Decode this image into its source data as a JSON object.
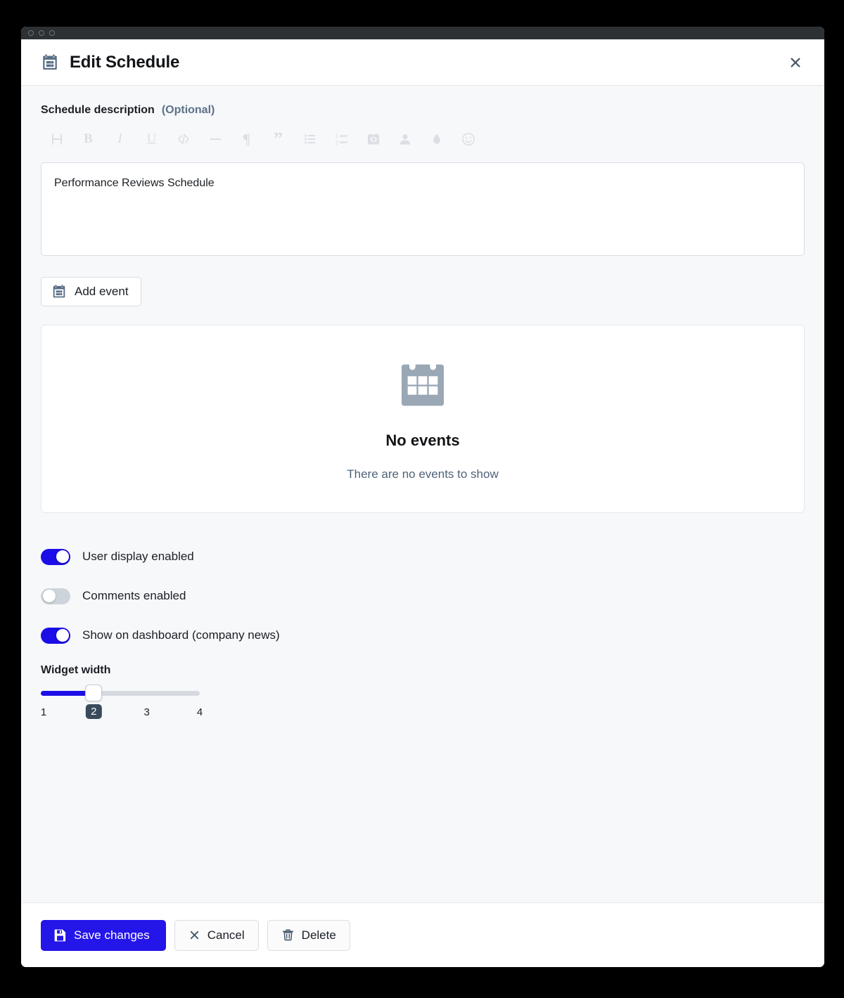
{
  "window": {
    "traffic_lights": [
      "close",
      "minimize",
      "zoom"
    ]
  },
  "header": {
    "icon": "calendar-icon",
    "title": "Edit Schedule",
    "close_icon": "close-icon"
  },
  "description_field": {
    "label": "Schedule description",
    "optional_tag": "(Optional)",
    "value": "Performance Reviews Schedule",
    "placeholder": ""
  },
  "rte_toolbar": {
    "items": [
      {
        "name": "heading-icon",
        "glyph": "H"
      },
      {
        "name": "bold-icon",
        "glyph": "B"
      },
      {
        "name": "italic-icon",
        "glyph": "I"
      },
      {
        "name": "underline-icon",
        "glyph": "U"
      },
      {
        "name": "code-icon",
        "glyph": "</>"
      },
      {
        "name": "horizontal-rule-icon",
        "glyph": "—"
      },
      {
        "name": "paragraph-icon",
        "glyph": "¶"
      },
      {
        "name": "blockquote-icon",
        "glyph": "”"
      },
      {
        "name": "bulleted-list-icon",
        "glyph": "list"
      },
      {
        "name": "numbered-list-icon",
        "glyph": "1-2"
      },
      {
        "name": "embed-media-icon",
        "glyph": "embed"
      },
      {
        "name": "mention-user-icon",
        "glyph": "person"
      },
      {
        "name": "highlight-color-icon",
        "glyph": "droplet"
      },
      {
        "name": "emoji-icon",
        "glyph": "smiley"
      }
    ]
  },
  "add_event": {
    "label": "Add event",
    "icon": "calendar-add-icon"
  },
  "events_panel": {
    "icon": "calendar-empty-icon",
    "title": "No events",
    "subtitle": "There are no events to show"
  },
  "toggles": [
    {
      "name": "user-display-enabled",
      "label": "User display enabled",
      "on": true
    },
    {
      "name": "comments-enabled",
      "label": "Comments enabled",
      "on": false
    },
    {
      "name": "show-on-dashboard",
      "label": "Show on dashboard (company news)",
      "on": true
    }
  ],
  "widget_width": {
    "label": "Widget width",
    "value": 2,
    "min": 1,
    "max": 4,
    "ticks": [
      "1",
      "2",
      "3",
      "4"
    ]
  },
  "footer": {
    "save_label": "Save changes",
    "save_icon": "save-icon",
    "cancel_label": "Cancel",
    "cancel_icon": "close-icon",
    "delete_label": "Delete",
    "delete_icon": "trash-icon"
  },
  "colors": {
    "accent_blue": "#2415e8",
    "toggle_on": "#1c0ee6",
    "icon_slate": "#566e85",
    "badge_dark": "#3a4a5b",
    "muted_text": "#4f6379"
  }
}
